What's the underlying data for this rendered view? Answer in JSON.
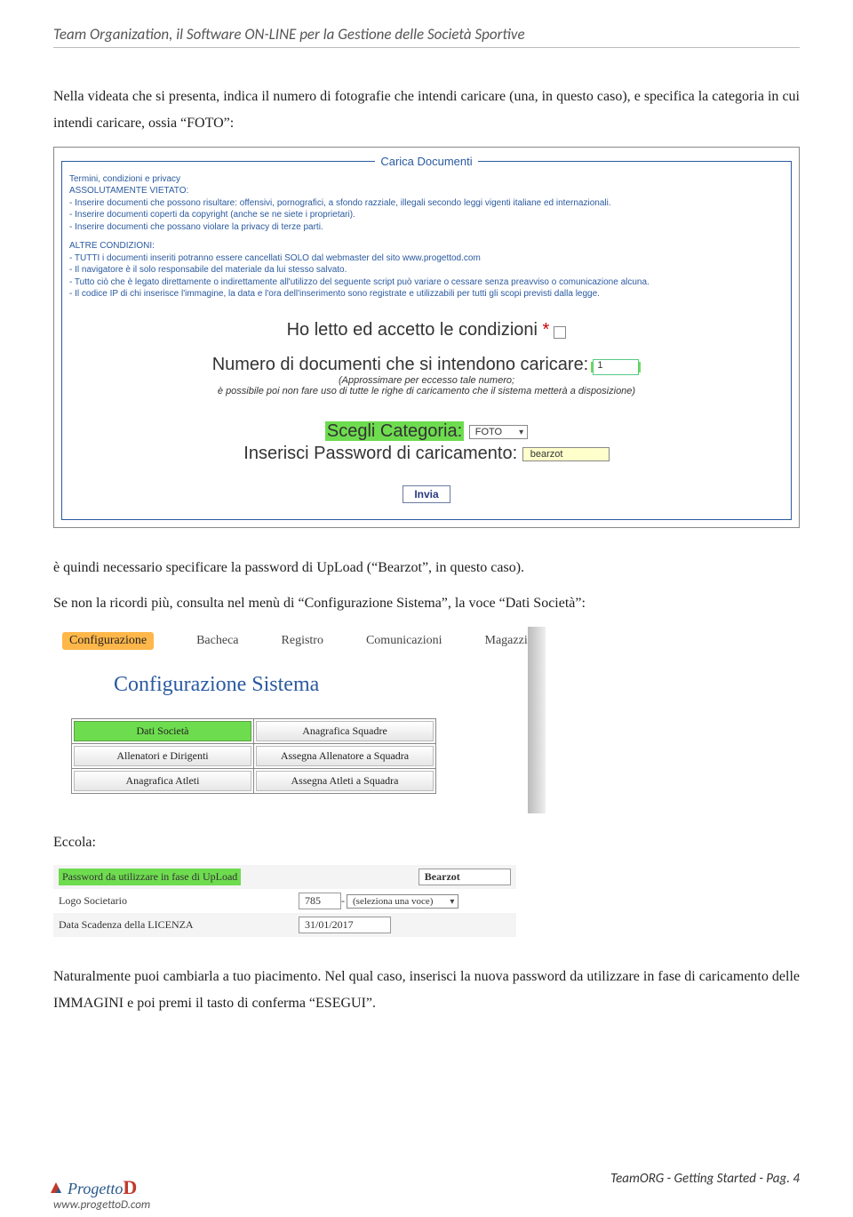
{
  "header": {
    "title": "Team Organization, il Software ON-LINE per la Gestione delle Società Sportive"
  },
  "para1": "Nella videata che si presenta, indica il numero di fotografie che intendi caricare (una, in questo caso), e specifica la categoria in cui intendi caricare, ossia “FOTO”:",
  "carica": {
    "legend": "Carica Documenti",
    "terms_title": "Termini, condizioni e privacy",
    "vietato": "ASSOLUTAMENTE VIETATO:",
    "v1": "- Inserire documenti che possono risultare: offensivi, pornografici, a sfondo razziale, illegali secondo leggi vigenti italiane ed internazionali.",
    "v2": "- Inserire documenti coperti da copyright (anche se ne siete i proprietari).",
    "v3": "- Inserire documenti che possano violare la privacy di terze parti.",
    "altre": "ALTRE CONDIZIONI:",
    "a1": "- TUTTI i documenti inseriti potranno essere cancellati SOLO dal webmaster del sito www.progettod.com",
    "a2": "- Il navigatore è il solo responsabile del materiale da lui stesso salvato.",
    "a3": "- Tutto ciò che è legato direttamente o indirettamente all'utilizzo del seguente script può variare o cessare senza preavviso o comunicazione alcuna.",
    "a4": "- Il codice IP di chi inserisce l'immagine, la data e l'ora dell'inserimento sono registrate e utilizzabili per tutti gli scopi previsti dalla legge.",
    "accept_label": "Ho letto ed accetto le condizioni ",
    "num_label": "Numero di documenti che si intendono caricare:",
    "num_value": "1",
    "approx1": "(Approssimare per eccesso tale numero;",
    "approx2": "è possibile poi non fare uso di tutte le righe di caricamento che il sistema metterà a disposizione)",
    "cat_label": "Scegli Categoria:",
    "cat_value": "FOTO",
    "pw_label": "Inserisci Password di caricamento:",
    "pw_value": "bearzot",
    "invia": "Invia"
  },
  "para2": "è quindi necessario specificare la password di UpLoad (“Bearzot”, in questo caso).",
  "para3": "Se non la ricordi più, consulta nel menù di “Configurazione Sistema”, la voce “Dati Società”:",
  "menu": {
    "tabs": [
      "Configurazione",
      "Bacheca",
      "Registro",
      "Comunicazioni",
      "Magazzino"
    ],
    "title": "Configurazione Sistema",
    "buttons": [
      [
        "Dati Società",
        "Anagrafica Squadre"
      ],
      [
        "Allenatori e Dirigenti",
        "Assegna Allenatore a Squadra"
      ],
      [
        "Anagrafica Atleti",
        "Assegna Atleti a Squadra"
      ]
    ]
  },
  "eccola": "Eccola:",
  "settings": {
    "r1_label": "Password da utilizzare in fase di UpLoad",
    "r1_value": "Bearzot",
    "r2_label": "Logo Societario",
    "r2_value_a": "785",
    "r2_value_b": "(seleziona una voce)",
    "r3_label": "Data Scadenza della LICENZA",
    "r3_value": "31/01/2017"
  },
  "para4": "Naturalmente puoi cambiarla a tuo piacimento. Nel qual caso, inserisci la nuova password da utilizzare in fase di caricamento delle IMMAGINI e poi premi il tasto di conferma “ESEGUI”.",
  "footer": {
    "line": "TeamORG - Getting Started - Pag. 4",
    "logo_pre": "Progetto",
    "logo_d": "D",
    "url": "www.progettoD.com"
  }
}
